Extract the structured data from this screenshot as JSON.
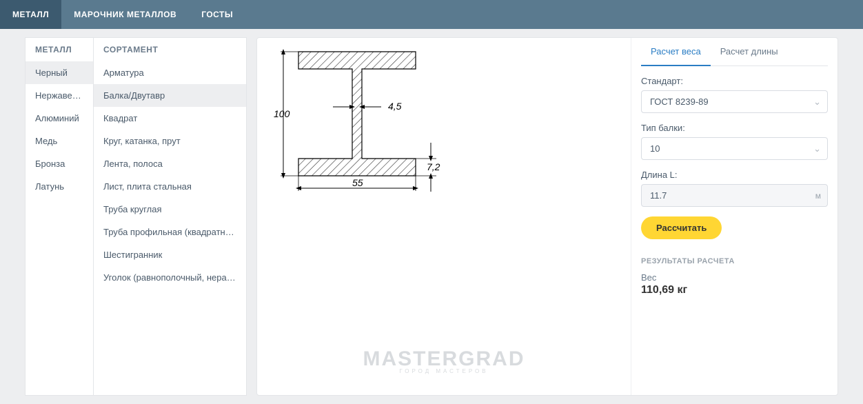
{
  "topnav": {
    "items": [
      {
        "label": "МЕТАЛЛ",
        "active": true
      },
      {
        "label": "МАРОЧНИК МЕТАЛЛОВ",
        "active": false
      },
      {
        "label": "ГОСТЫ",
        "active": false
      }
    ]
  },
  "col_metal": {
    "header": "МЕТАЛЛ",
    "items": [
      {
        "label": "Черный",
        "active": true
      },
      {
        "label": "Нержавейка",
        "active": false
      },
      {
        "label": "Алюминий",
        "active": false
      },
      {
        "label": "Медь",
        "active": false
      },
      {
        "label": "Бронза",
        "active": false
      },
      {
        "label": "Латунь",
        "active": false
      }
    ]
  },
  "col_sort": {
    "header": "СОРТАМЕНТ",
    "items": [
      {
        "label": "Арматура",
        "active": false
      },
      {
        "label": "Балка/Двутавр",
        "active": true
      },
      {
        "label": "Квадрат",
        "active": false
      },
      {
        "label": "Круг, катанка, прут",
        "active": false
      },
      {
        "label": "Лента, полоса",
        "active": false
      },
      {
        "label": "Лист, плита стальная",
        "active": false
      },
      {
        "label": "Труба круглая",
        "active": false
      },
      {
        "label": "Труба профильная (квадратная / прямоугольная)",
        "active": false
      },
      {
        "label": "Шестигранник",
        "active": false
      },
      {
        "label": "Уголок (равнополочный, неравнополочный)",
        "active": false
      }
    ]
  },
  "diagram": {
    "height": "100",
    "width": "55",
    "web": "4,5",
    "flange": "7,2"
  },
  "watermark": {
    "main": "MASTERGRAD",
    "sub": "ГОРОД МАСТЕРОВ"
  },
  "form": {
    "tabs": [
      {
        "label": "Расчет веса",
        "active": true
      },
      {
        "label": "Расчет длины",
        "active": false
      }
    ],
    "standard_label": "Стандарт:",
    "standard_value": "ГОСТ 8239-89",
    "type_label": "Тип балки:",
    "type_value": "10",
    "length_label": "Длина L:",
    "length_value": "11.7",
    "length_unit": "м",
    "calc_button": "Рассчитать",
    "results_header": "РЕЗУЛЬТАТЫ РАСЧЕТА",
    "weight_label": "Вес",
    "weight_value": "110,69 кг"
  }
}
